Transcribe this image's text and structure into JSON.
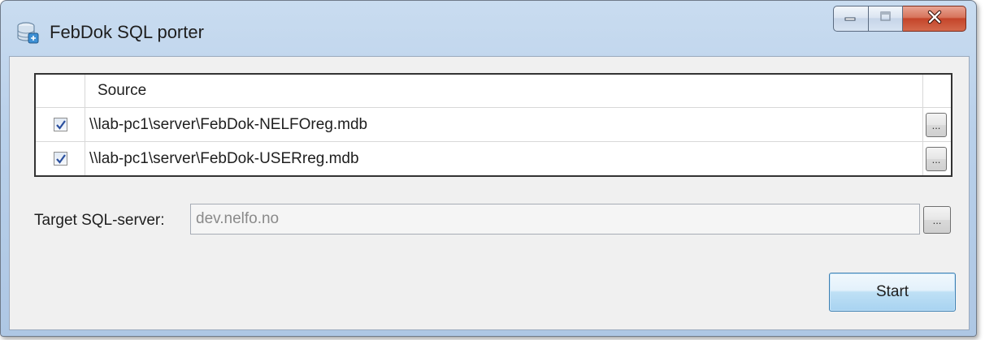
{
  "window": {
    "title": "FebDok SQL porter"
  },
  "caption_buttons": {
    "minimize_icon": "minimize-icon",
    "maximize_icon": "maximize-icon",
    "close_icon": "close-icon"
  },
  "grid": {
    "columns": [
      "",
      "Source",
      ""
    ],
    "rows": [
      {
        "checked": true,
        "path": "\\\\lab-pc1\\server\\FebDok-NELFOreg.mdb",
        "browse_label": "..."
      },
      {
        "checked": true,
        "path": "\\\\lab-pc1\\server\\FebDok-USERreg.mdb",
        "browse_label": "..."
      }
    ]
  },
  "target": {
    "label": "Target SQL-server:",
    "value": "dev.nelfo.no",
    "browse_label": "..."
  },
  "actions": {
    "start_label": "Start"
  },
  "colors": {
    "title_bar": "#b9d0ea",
    "client_bg": "#f0f0f0",
    "close_button": "#c4452a",
    "default_button": "#a8d3f1",
    "checkmark": "#2a4f9e"
  }
}
